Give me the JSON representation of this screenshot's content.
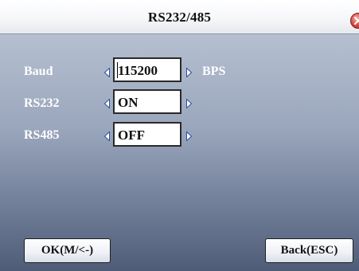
{
  "window": {
    "title": "RS232/485",
    "close_icon": "close-icon",
    "close_color": "#d9534a"
  },
  "fields": [
    {
      "label": "Baud",
      "value": "115200",
      "unit": "BPS",
      "focused": true
    },
    {
      "label": "RS232",
      "value": "ON"
    },
    {
      "label": "RS485",
      "value": "OFF"
    }
  ],
  "buttons": {
    "ok_label": "OK(M/<-)",
    "back_label": "Back(ESC)"
  },
  "colors": {
    "arrow": "#ffffff",
    "arrow_shade": "#2f4e9a"
  }
}
